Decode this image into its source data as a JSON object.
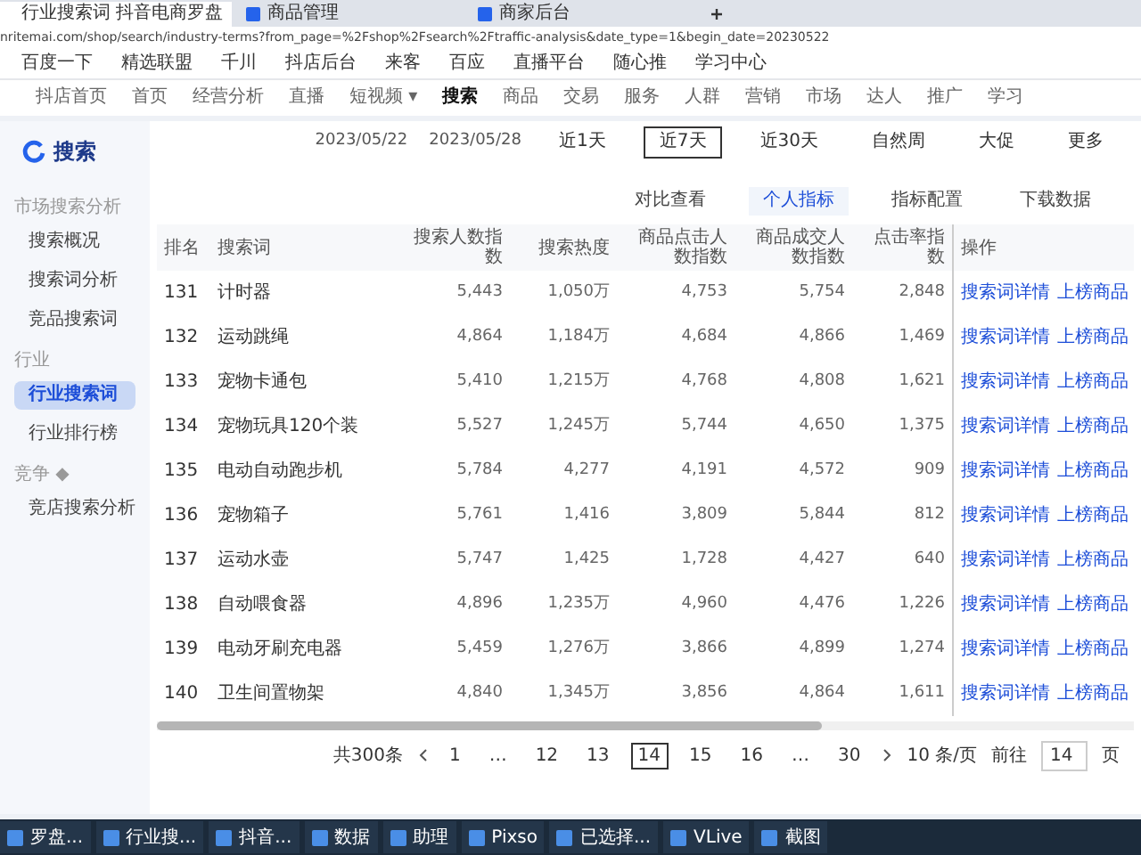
{
  "browser_tabs": [
    {
      "title": "行业搜索词 抖音电商罗盘",
      "selected": true
    },
    {
      "title": "商品管理",
      "selected": false
    },
    {
      "title": "商家后台",
      "selected": false
    }
  ],
  "address": "nritemai.com/shop/search/industry-terms?from_page=%2Fshop%2Fsearch%2Ftraffic-analysis&date_type=1&begin_date=20230522",
  "bookmarks": [
    "百度一下",
    "精选联盟",
    "千川",
    "抖店后台",
    "来客",
    "百应",
    "直播平台",
    "随心推",
    "学习中心"
  ],
  "site_nav": [
    {
      "label": "抖店首页",
      "selected": false
    },
    {
      "label": "首页",
      "selected": false
    },
    {
      "label": "经营分析",
      "selected": false
    },
    {
      "label": "直播",
      "selected": false
    },
    {
      "label": "短视频 ▾",
      "selected": false
    },
    {
      "label": "搜索",
      "selected": true
    },
    {
      "label": "商品",
      "selected": false
    },
    {
      "label": "交易",
      "selected": false
    },
    {
      "label": "服务",
      "selected": false
    },
    {
      "label": "人群",
      "selected": false
    },
    {
      "label": "营销",
      "selected": false
    },
    {
      "label": "市场",
      "selected": false
    },
    {
      "label": "达人",
      "selected": false
    },
    {
      "label": "推广",
      "selected": false
    },
    {
      "label": "学习",
      "selected": false
    }
  ],
  "brand": "搜索",
  "sidebar": [
    {
      "kind": "section",
      "label": "市场搜索分析"
    },
    {
      "kind": "item",
      "label": "搜索概况",
      "selected": false
    },
    {
      "kind": "item",
      "label": "搜索词分析",
      "selected": false
    },
    {
      "kind": "item",
      "label": "竞品搜索词",
      "selected": false
    },
    {
      "kind": "section",
      "label": "行业"
    },
    {
      "kind": "item",
      "label": "行业搜索词",
      "selected": true
    },
    {
      "kind": "item",
      "label": "行业排行榜",
      "selected": false
    },
    {
      "kind": "section",
      "label": "竞争 ◆"
    },
    {
      "kind": "locked",
      "label": "竞店搜索分析",
      "selected": false
    }
  ],
  "date_start": "2023/05/22",
  "date_end": "2023/05/28",
  "periods": [
    {
      "label": "近1天",
      "selected": false
    },
    {
      "label": "近7天",
      "selected": true
    },
    {
      "label": "近30天",
      "selected": false
    },
    {
      "label": "自然周",
      "selected": false
    },
    {
      "label": "大促",
      "selected": false
    },
    {
      "label": "更多",
      "selected": false
    }
  ],
  "toolbar": [
    "对比查看",
    "个人指标",
    "指标配置",
    "下载数据"
  ],
  "table": {
    "columns": [
      "排名",
      "搜索词",
      "搜索人数指数",
      "搜索热度",
      "商品点击人数指数",
      "商品成交人数指数",
      "点击率指数",
      "操作"
    ],
    "rows": [
      [
        "131",
        "计时器",
        "5,443",
        "1,050万",
        "4,753",
        "5,754",
        "2,848",
        "搜索词详情",
        "上榜商品"
      ],
      [
        "132",
        "运动跳绳",
        "4,864",
        "1,184万",
        "4,684",
        "4,866",
        "1,469",
        "搜索词详情",
        "上榜商品"
      ],
      [
        "133",
        "宠物卡通包",
        "5,410",
        "1,215万",
        "4,768",
        "4,808",
        "1,621",
        "搜索词详情",
        "上榜商品"
      ],
      [
        "134",
        "宠物玩具120个装",
        "5,527",
        "1,245万",
        "5,744",
        "4,650",
        "1,375",
        "搜索词详情",
        "上榜商品"
      ],
      [
        "135",
        "电动自动跑步机",
        "5,784",
        "4,277",
        "4,191",
        "4,572",
        "909",
        "搜索词详情",
        "上榜商品"
      ],
      [
        "136",
        "宠物箱子",
        "5,761",
        "1,416",
        "3,809",
        "5,844",
        "812",
        "搜索词详情",
        "上榜商品"
      ],
      [
        "137",
        "运动水壶",
        "5,747",
        "1,425",
        "1,728",
        "4,427",
        "640",
        "搜索词详情",
        "上榜商品"
      ],
      [
        "138",
        "自动喂食器",
        "4,896",
        "1,235万",
        "4,960",
        "4,476",
        "1,226",
        "搜索词详情",
        "上榜商品"
      ],
      [
        "139",
        "电动牙刷充电器",
        "5,459",
        "1,276万",
        "3,866",
        "4,899",
        "1,274",
        "搜索词详情",
        "上榜商品"
      ],
      [
        "140",
        "卫生间置物架",
        "4,840",
        "1,345万",
        "3,856",
        "4,864",
        "1,611",
        "搜索词详情",
        "上榜商品"
      ]
    ]
  },
  "scroll": {
    "level": 0.68
  },
  "pagination": {
    "total": "共300条",
    "pages": [
      {
        "label": "1",
        "selected": false
      },
      {
        "label": "…",
        "selected": false
      },
      {
        "label": "12",
        "selected": false
      },
      {
        "label": "13",
        "selected": false
      },
      {
        "label": "14",
        "selected": true
      },
      {
        "label": "15",
        "selected": false
      },
      {
        "label": "16",
        "selected": false
      },
      {
        "label": "…",
        "selected": false
      },
      {
        "label": "30",
        "selected": false
      }
    ],
    "page_size": "10 条/页",
    "goto": "前往",
    "goto_value": "14",
    "unit": "页"
  },
  "taskbar": [
    "罗盘...",
    "行业搜...",
    "抖音...",
    "数据",
    "助理",
    "Pixso",
    "已选择...",
    "VLive",
    "截图"
  ]
}
